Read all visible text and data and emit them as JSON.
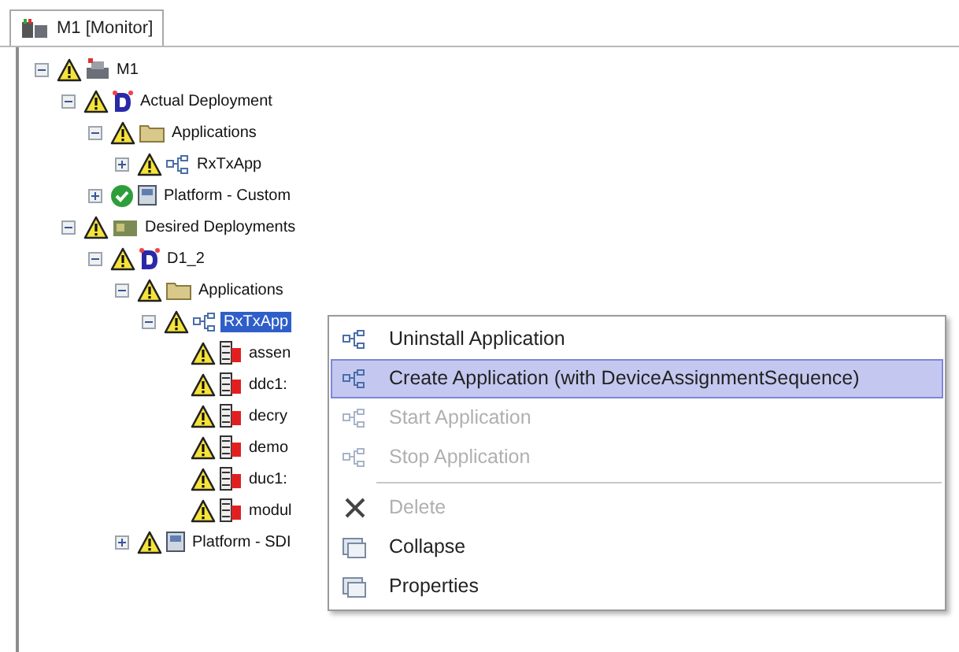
{
  "tab": {
    "label": "M1 [Monitor]",
    "selected": true
  },
  "tree": [
    {
      "label": "M1",
      "warning": true,
      "kind": "computer",
      "expanded": true,
      "selected": false,
      "children": [
        {
          "label": "Actual Deployment",
          "warning": true,
          "kind": "deployment",
          "expanded": true,
          "selected": false,
          "children": [
            {
              "label": "Applications",
              "warning": true,
              "kind": "folder",
              "expanded": true,
              "selected": false,
              "children": [
                {
                  "label": "RxTxApp",
                  "warning": true,
                  "kind": "application",
                  "expanded": false,
                  "selected": false
                }
              ]
            },
            {
              "label": "Platform - Custom",
              "warning": false,
              "kind": "platform",
              "expanded": false,
              "selected": false
            }
          ]
        },
        {
          "label": "Desired Deployments",
          "warning": true,
          "kind": "deployments",
          "expanded": true,
          "selected": false,
          "children": [
            {
              "label": "D1_2",
              "warning": true,
              "kind": "deployment",
              "expanded": true,
              "selected": false,
              "children": [
                {
                  "label": "Applications",
                  "warning": true,
                  "kind": "folder",
                  "expanded": true,
                  "selected": false,
                  "children": [
                    {
                      "label": "RxTxApp",
                      "warning": true,
                      "kind": "application",
                      "expanded": true,
                      "selected": true,
                      "children": [
                        {
                          "label": "assen",
                          "warning": true,
                          "kind": "component",
                          "selected": false
                        },
                        {
                          "label": "ddc1:",
                          "warning": true,
                          "kind": "component",
                          "selected": false
                        },
                        {
                          "label": "decry",
                          "warning": true,
                          "kind": "component",
                          "selected": false
                        },
                        {
                          "label": "demo",
                          "warning": true,
                          "kind": "component",
                          "selected": false
                        },
                        {
                          "label": "duc1:",
                          "warning": true,
                          "kind": "component",
                          "selected": false
                        },
                        {
                          "label": "modul",
                          "warning": true,
                          "kind": "component",
                          "selected": false
                        }
                      ]
                    }
                  ]
                },
                {
                  "label": "Platform - SDI",
                  "warning": true,
                  "kind": "platform",
                  "expanded": false,
                  "selected": false
                }
              ]
            }
          ]
        }
      ]
    }
  ],
  "context_menu": [
    {
      "label": "Uninstall Application",
      "kind": "application",
      "disabled": false,
      "selected": false,
      "separator_before": false
    },
    {
      "label": "Create Application (with DeviceAssignmentSequence)",
      "kind": "application",
      "disabled": false,
      "selected": true,
      "separator_before": false
    },
    {
      "label": "Start Application",
      "kind": "application",
      "disabled": true,
      "selected": false,
      "separator_before": false
    },
    {
      "label": "Stop Application",
      "kind": "application",
      "disabled": true,
      "selected": false,
      "separator_before": false
    },
    {
      "label": "Delete",
      "kind": "delete",
      "disabled": true,
      "selected": false,
      "separator_before": true
    },
    {
      "label": "Collapse",
      "kind": "window",
      "disabled": false,
      "selected": false,
      "separator_before": false
    },
    {
      "label": "Properties",
      "kind": "window",
      "disabled": false,
      "selected": false,
      "separator_before": false
    }
  ]
}
